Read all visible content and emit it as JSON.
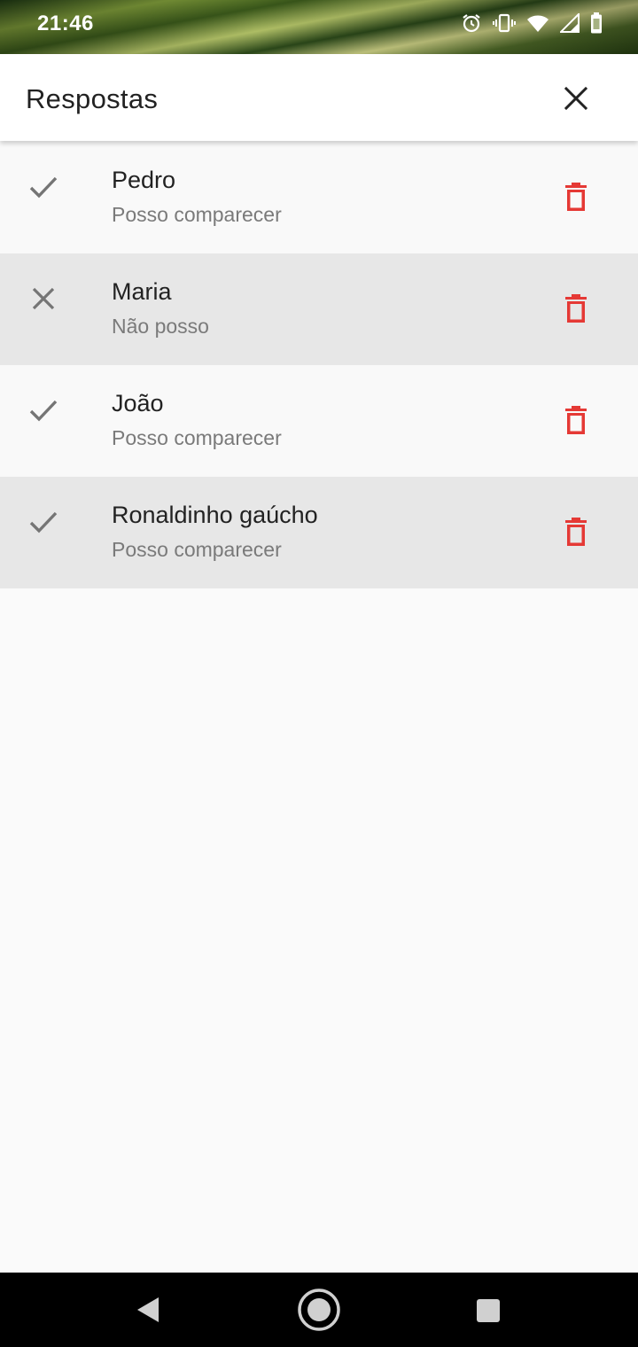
{
  "status_bar": {
    "time": "21:46",
    "icons": [
      "alarm-icon",
      "vibrate-icon",
      "wifi-icon",
      "signal-icon",
      "battery-icon"
    ]
  },
  "app_bar": {
    "title": "Respostas",
    "close_icon": "close-icon"
  },
  "colors": {
    "delete": "#e53935",
    "status_icon": "#757575",
    "alt_row": "#e7e7e7",
    "plain_row": "#f9f9f9"
  },
  "responses": [
    {
      "name": "Pedro",
      "status": "Posso comparecer",
      "icon": "check-icon"
    },
    {
      "name": "Maria",
      "status": "Não posso",
      "icon": "close-icon"
    },
    {
      "name": "João",
      "status": "Posso comparecer",
      "icon": "check-icon"
    },
    {
      "name": "Ronaldinho gaúcho",
      "status": "Posso comparecer",
      "icon": "check-icon"
    }
  ],
  "nav_bar": {
    "buttons": [
      "back-icon",
      "home-icon",
      "recent-apps-icon"
    ]
  }
}
